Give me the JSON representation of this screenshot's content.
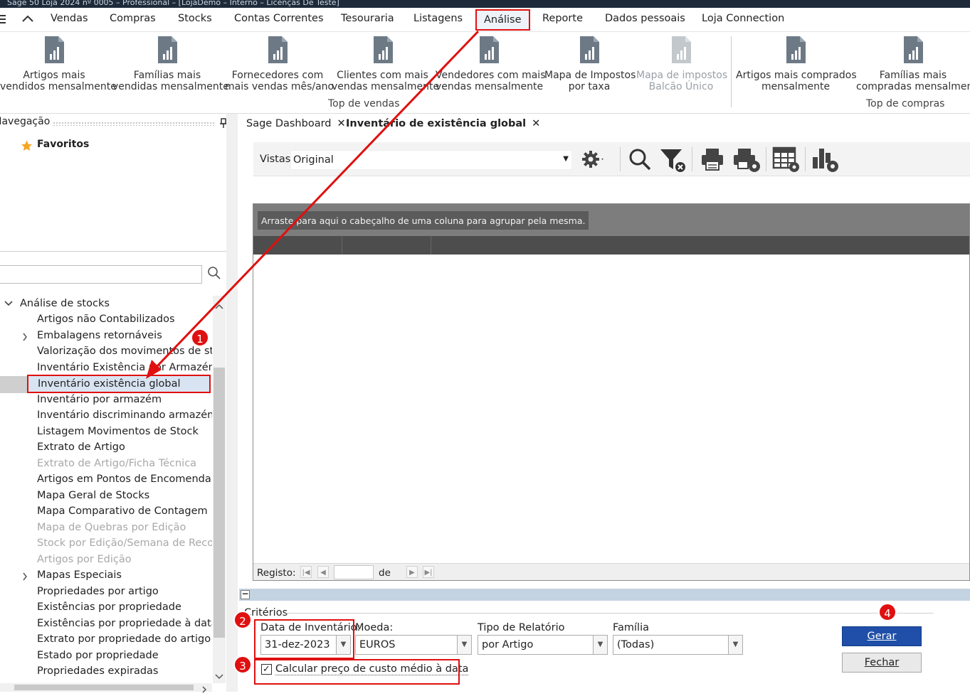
{
  "window": {
    "title": "Sage 50 Loja 2024 nº 0005 – Professional – [LojaDemo – Interno – Licenças De Teste]"
  },
  "menu": {
    "items": [
      "Vendas",
      "Compras",
      "Stocks",
      "Contas Correntes",
      "Tesouraria",
      "Listagens",
      "Análise",
      "Reporte",
      "Dados pessoais",
      "Loja Connection"
    ],
    "active": "Análise"
  },
  "ribbon": {
    "buttons": [
      {
        "l1": "Artigos mais",
        "l2": "vendidos mensalmente",
        "enabled": true
      },
      {
        "l1": "Famílias mais",
        "l2": "vendidas mensalmente",
        "enabled": true
      },
      {
        "l1": "Fornecedores com",
        "l2": "mais vendas mês/ano",
        "enabled": true
      },
      {
        "l1": "Clientes com mais",
        "l2": "vendas mensalmente",
        "enabled": true
      },
      {
        "l1": "Vendedores com mais",
        "l2": "vendas mensalmente",
        "enabled": true
      },
      {
        "l1": "Mapa de Impostos",
        "l2": "por taxa",
        "enabled": true
      },
      {
        "l1": "Mapa de impostos",
        "l2": "Balcão Único",
        "enabled": false
      },
      {
        "l1": "Artigos mais comprados",
        "l2": "mensalmente",
        "enabled": true
      },
      {
        "l1": "Famílias mais",
        "l2": "compradas mensalmente",
        "enabled": true
      }
    ],
    "groups": [
      "Top de vendas",
      "Top de compras"
    ]
  },
  "nav": {
    "header": "Navegação",
    "favorites": "Favoritos",
    "search_placeholder": "",
    "tree_root": "Análise de stocks",
    "items": [
      {
        "label": "Artigos não Contabilizados",
        "enabled": true
      },
      {
        "label": "Embalagens retornáveis",
        "enabled": true,
        "expandable": true
      },
      {
        "label": "Valorização dos movimentos de stock",
        "enabled": true
      },
      {
        "label": "Inventário Existência por Armazém",
        "enabled": true
      },
      {
        "label": "Inventário existência global",
        "enabled": true,
        "selected": true
      },
      {
        "label": "Inventário por armazém",
        "enabled": true
      },
      {
        "label": "Inventário discriminando armazéns",
        "enabled": true
      },
      {
        "label": "Listagem Movimentos de Stock",
        "enabled": true
      },
      {
        "label": "Extrato de Artigo",
        "enabled": true
      },
      {
        "label": "Extrato de Artigo/Ficha Técnica",
        "enabled": false
      },
      {
        "label": "Artigos em Pontos de Encomenda",
        "enabled": true
      },
      {
        "label": "Mapa Geral de Stocks",
        "enabled": true
      },
      {
        "label": "Mapa Comparativo de Contagem",
        "enabled": true
      },
      {
        "label": "Mapa de Quebras por Edição",
        "enabled": false
      },
      {
        "label": "Stock por Edição/Semana de Recolha",
        "enabled": false
      },
      {
        "label": "Artigos por Edição",
        "enabled": false
      },
      {
        "label": "Mapas Especiais",
        "enabled": true,
        "expandable": true
      },
      {
        "label": "Propriedades por artigo",
        "enabled": true
      },
      {
        "label": "Existências por propriedade",
        "enabled": true
      },
      {
        "label": "Existências por propriedade à data",
        "enabled": true
      },
      {
        "label": "Extrato por propriedade do artigo",
        "enabled": true
      },
      {
        "label": "Estado por propriedade",
        "enabled": true
      },
      {
        "label": "Propriedades expiradas",
        "enabled": true
      }
    ]
  },
  "tabs": [
    {
      "label": "Sage Dashboard",
      "active": false
    },
    {
      "label": "Inventário de existência global",
      "active": true
    }
  ],
  "toolbar": {
    "views_label": "Vistas",
    "views_value": "Original"
  },
  "grid": {
    "group_hint": "Arraste para aqui o cabeçalho de uma coluna para agrupar pela mesma.",
    "record_label": "Registo:",
    "record_value": "",
    "of_label": "de"
  },
  "criteria": {
    "title": "Critérios",
    "date_label": "Data de Inventário:",
    "date_value": "31-dez-2023",
    "currency_label": "Moeda:",
    "currency_value": "EUROS",
    "report_type_label": "Tipo de Relatório",
    "report_type_value": "por Artigo",
    "family_label": "Família",
    "family_value": "(Todas)",
    "avg_cost_label": "Calcular preço de custo médio à data",
    "avg_cost_checked": true,
    "generate_label": "Gerar",
    "close_label": "Fechar"
  },
  "annotations": {
    "steps": [
      "1",
      "2",
      "3",
      "4"
    ],
    "highlight_color": "#e01010"
  }
}
